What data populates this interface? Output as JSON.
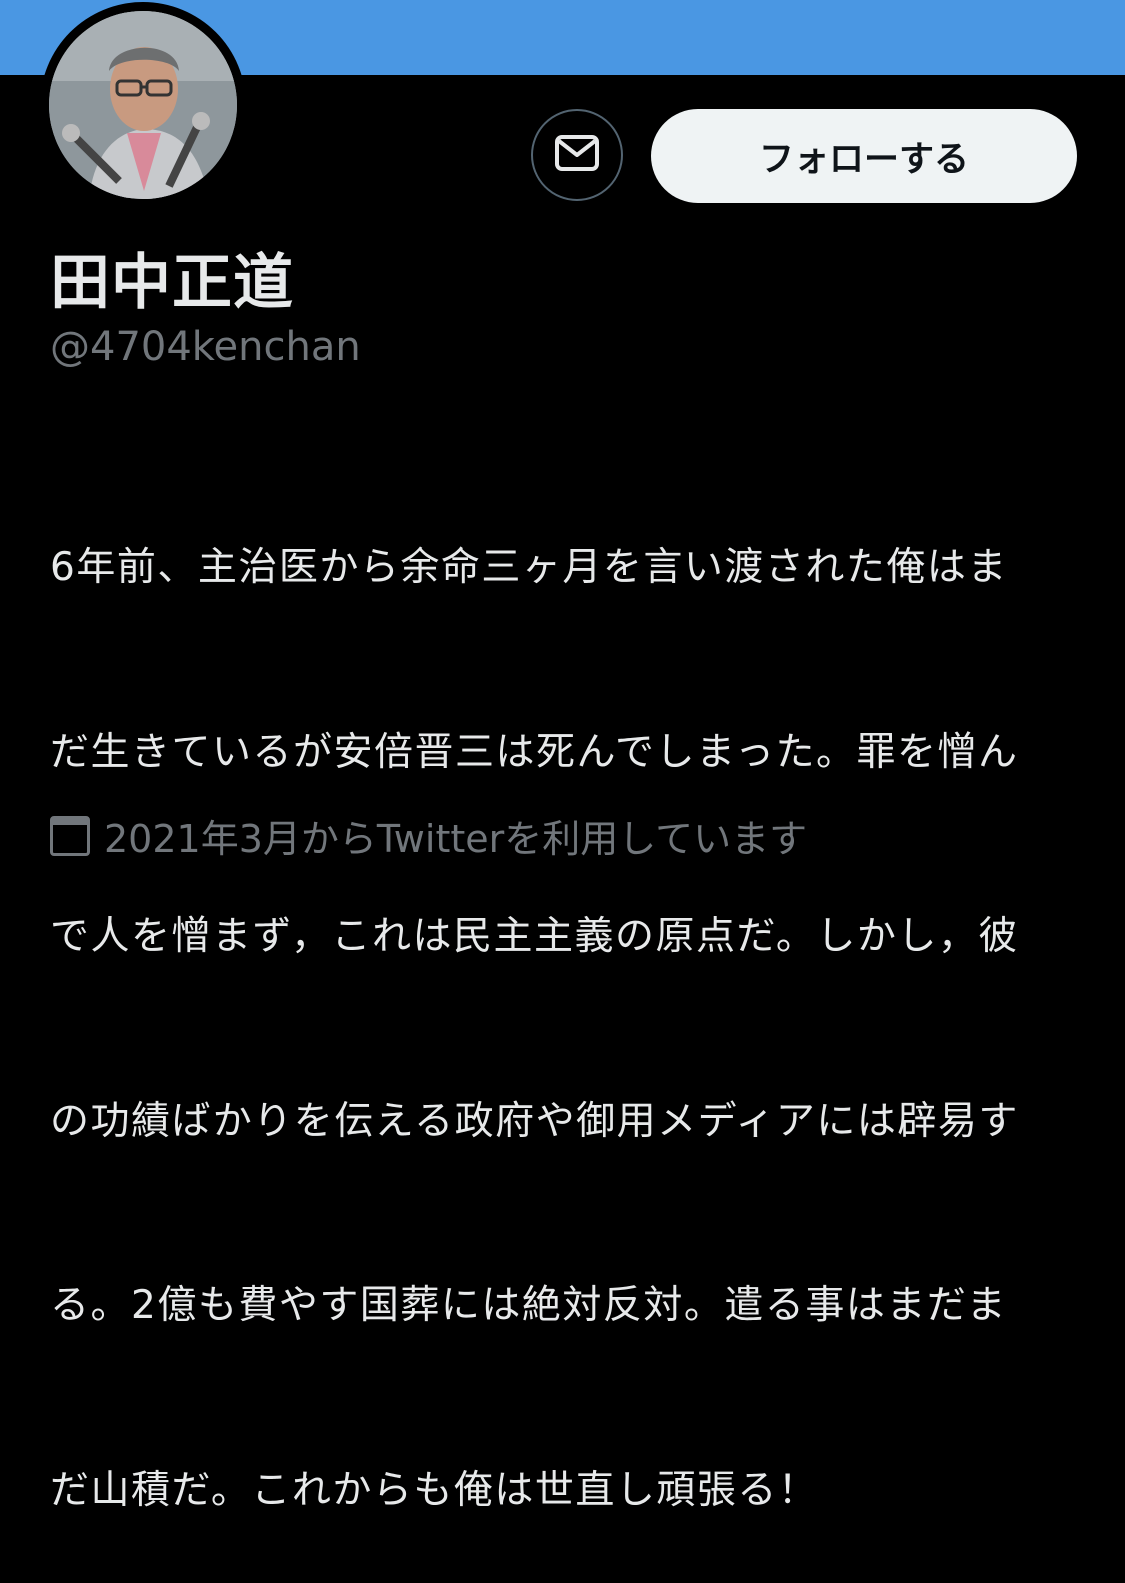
{
  "colors": {
    "banner": "#4a97e3",
    "background": "#000000",
    "primary_text": "#e7e9ea",
    "secondary_text": "#71767b",
    "follow_button_bg": "#eff3f4"
  },
  "profile": {
    "display_name": "田中正道",
    "handle": "@4704kenchan",
    "bio_lines": [
      "6年前、主治医から余命三ヶ月を言い渡された俺はま",
      "だ生きているが安倍晋三は死んでしまった。罪を憎ん",
      "で人を憎まず，これは民主主義の原点だ。しかし，彼",
      "の功績ばかりを伝える政府や御用メディアには辟易す",
      "る。2億も費やす国葬には絶対反対。遣る事はまだま",
      "だ山積だ。これからも俺は世直し頑張る！"
    ],
    "join_text": "2021年3月からTwitterを利用しています"
  },
  "actions": {
    "message_icon": "envelope-icon",
    "follow_label": "フォローする"
  }
}
